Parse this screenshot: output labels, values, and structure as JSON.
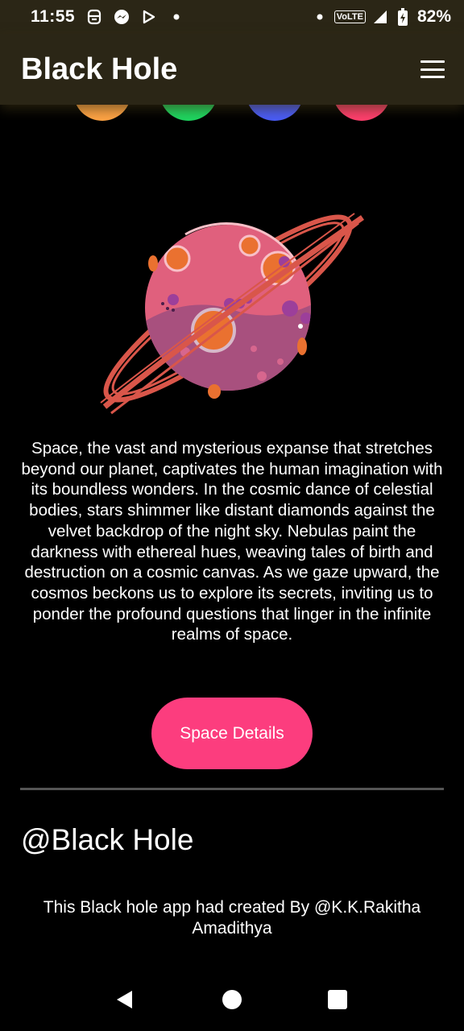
{
  "status_bar": {
    "time": "11:55",
    "volte": "VoLTE",
    "battery": "82%",
    "icons": [
      "app-notification-icon",
      "messenger-icon",
      "play-store-icon",
      "dot-icon",
      "signal-icon",
      "battery-icon"
    ]
  },
  "app_bar": {
    "title": "Black Hole",
    "menu_icon": "hamburger-menu-icon"
  },
  "color_circles": [
    "#ffa445",
    "#1ed760",
    "#4a5cf7",
    "#ff3f6d"
  ],
  "main": {
    "description": "Space, the vast and mysterious expanse that stretches beyond our planet, captivates the human imagination with its boundless wonders. In the cosmic dance of celestial bodies, stars shimmer like distant diamonds against the velvet backdrop of the night sky. Nebulas paint the darkness with ethereal hues, weaving tales of birth and destruction on a cosmic canvas. As we gaze upward, the cosmos beckons us to explore its secrets, inviting us to ponder the profound questions that linger in the infinite realms of space.",
    "button_label": "Space Details"
  },
  "footer": {
    "title": "@Black Hole",
    "credit": "This Black hole app had created By @K.K.Rakitha Amadithya"
  },
  "nav_bar": {
    "icons": [
      "back-icon",
      "home-icon",
      "recents-icon"
    ]
  }
}
